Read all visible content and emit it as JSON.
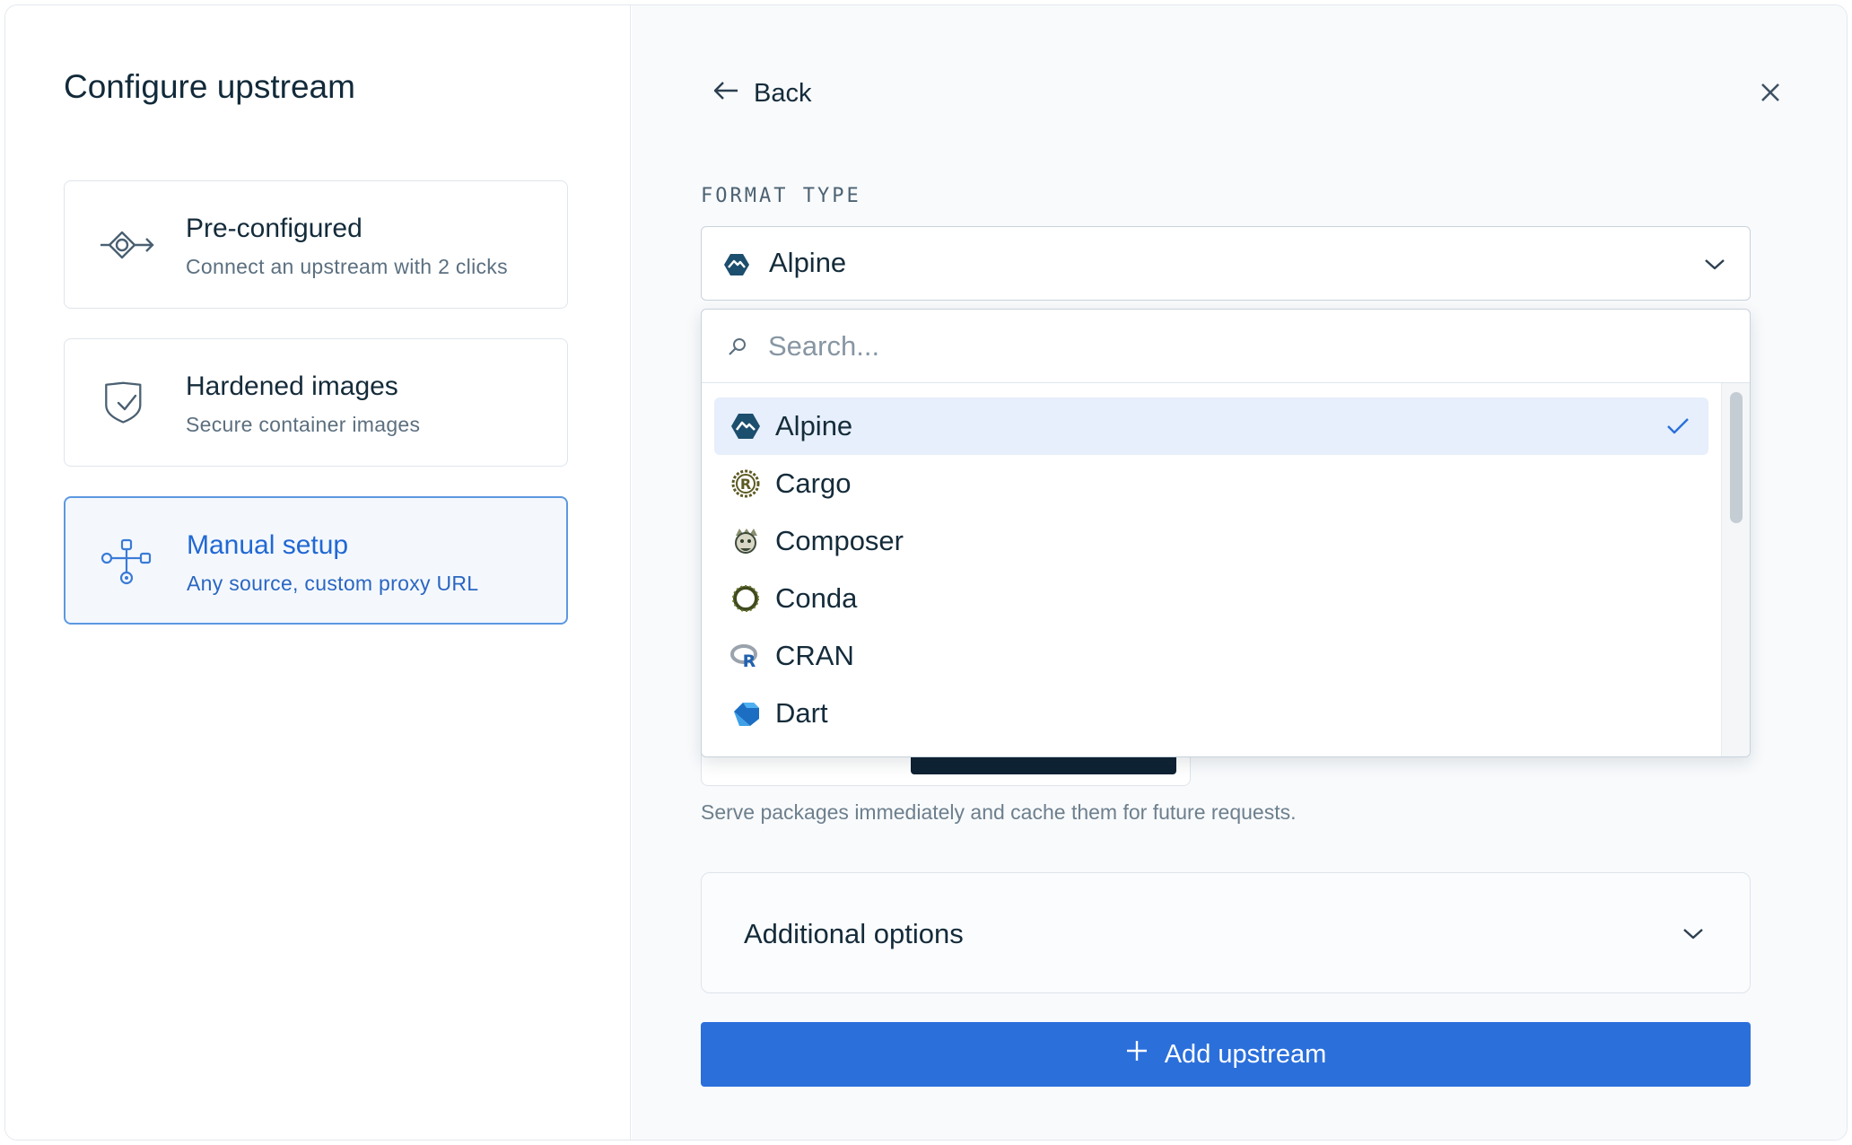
{
  "left": {
    "title": "Configure upstream",
    "options": [
      {
        "title": "Pre-configured",
        "subtitle": "Connect an upstream with 2 clicks",
        "icon": "preconfigured-icon",
        "selected": false
      },
      {
        "title": "Hardened images",
        "subtitle": "Secure container images",
        "icon": "shield-check-icon",
        "selected": false
      },
      {
        "title": "Manual setup",
        "subtitle": "Any source, custom proxy URL",
        "icon": "network-nodes-icon",
        "selected": true
      }
    ]
  },
  "right": {
    "back_label": "Back",
    "close_icon": "close-icon",
    "format_label": "FORMAT TYPE",
    "selected_format": "Alpine",
    "search_placeholder": "Search...",
    "formats": [
      {
        "label": "Alpine",
        "icon": "alpine-icon",
        "selected": true
      },
      {
        "label": "Cargo",
        "icon": "cargo-icon",
        "selected": false
      },
      {
        "label": "Composer",
        "icon": "composer-icon",
        "selected": false
      },
      {
        "label": "Conda",
        "icon": "conda-icon",
        "selected": false
      },
      {
        "label": "CRAN",
        "icon": "cran-icon",
        "selected": false
      },
      {
        "label": "Dart",
        "icon": "dart-icon",
        "selected": false
      }
    ],
    "helper_text": "Serve packages immediately and cache them for future requests.",
    "additional_options_label": "Additional options",
    "add_button_label": "Add upstream"
  },
  "colors": {
    "accent": "#2b6fdb",
    "selected_border": "#5d98e0",
    "selected_row": "#e6effb",
    "dark_navy": "#0e2233"
  }
}
